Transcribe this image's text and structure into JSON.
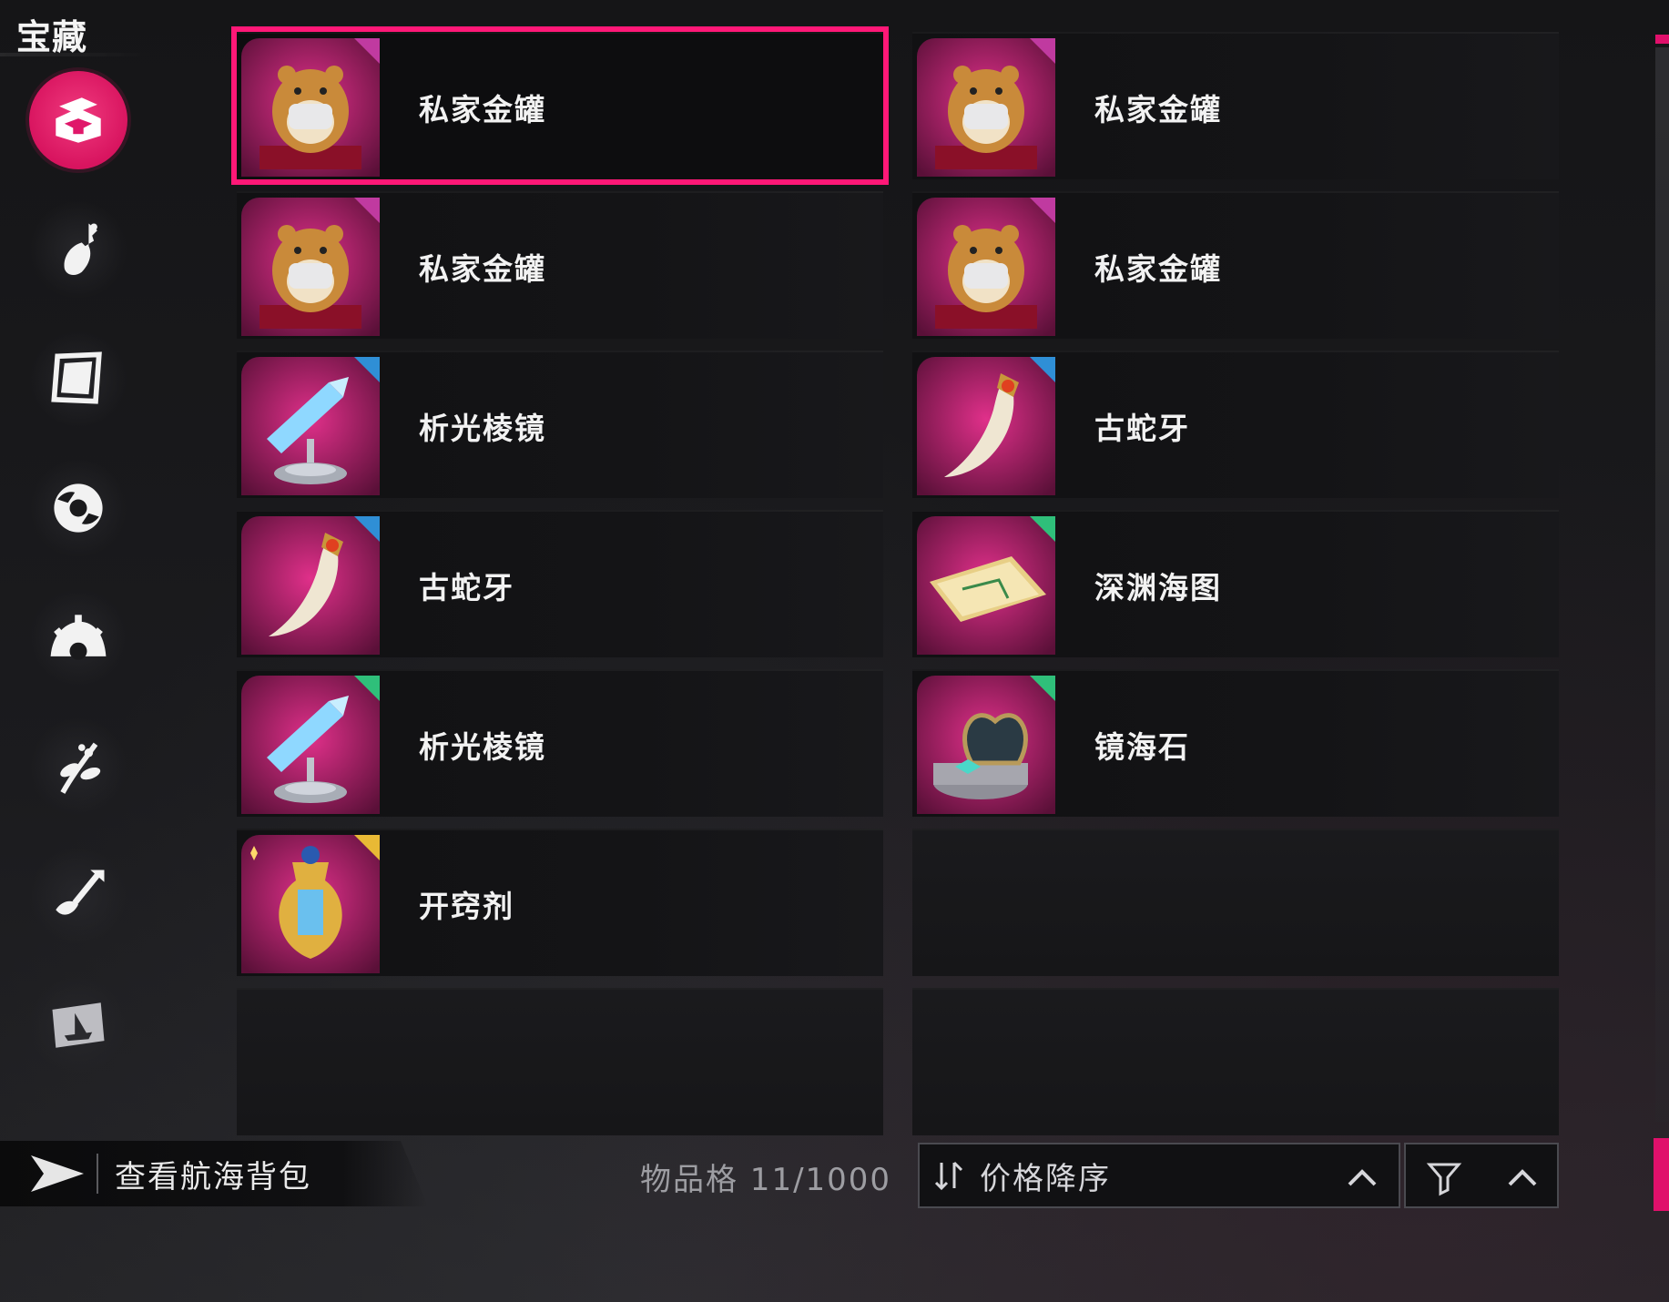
{
  "page_title": "宝藏",
  "colors": {
    "accent": "#ff1877",
    "active_category": "#e0186a",
    "rarity_purple": "#c03aa0",
    "rarity_blue": "#2f8fd6",
    "rarity_green": "#2fbf7a",
    "rarity_gold": "#e8b935"
  },
  "categories": [
    {
      "icon": "treasure-chest-icon",
      "active": true
    },
    {
      "icon": "bottle-icon",
      "active": false
    },
    {
      "icon": "card-frame-icon",
      "active": false
    },
    {
      "icon": "gear-icon",
      "active": false
    },
    {
      "icon": "half-gear-icon",
      "active": false
    },
    {
      "icon": "plant-sprig-icon",
      "active": false
    },
    {
      "icon": "shovel-icon",
      "active": false
    },
    {
      "icon": "sail-map-icon",
      "active": false
    }
  ],
  "items": [
    {
      "name": "私家金罐",
      "art": "hamster-pot",
      "rarity": "purple",
      "selected": true
    },
    {
      "name": "私家金罐",
      "art": "hamster-pot",
      "rarity": "purple",
      "selected": false
    },
    {
      "name": "私家金罐",
      "art": "hamster-pot",
      "rarity": "purple",
      "selected": false
    },
    {
      "name": "私家金罐",
      "art": "hamster-pot",
      "rarity": "purple",
      "selected": false
    },
    {
      "name": "析光棱镜",
      "art": "crystal-prism",
      "rarity": "blue",
      "selected": false
    },
    {
      "name": "古蛇牙",
      "art": "serpent-fang",
      "rarity": "blue",
      "selected": false
    },
    {
      "name": "古蛇牙",
      "art": "serpent-fang",
      "rarity": "blue",
      "selected": false
    },
    {
      "name": "深渊海图",
      "art": "sea-chart",
      "rarity": "green",
      "selected": false
    },
    {
      "name": "析光棱镜",
      "art": "crystal-prism",
      "rarity": "green",
      "selected": false
    },
    {
      "name": "镜海石",
      "art": "jewel-box",
      "rarity": "green",
      "selected": false
    },
    {
      "name": "开窍剂",
      "art": "golden-flask",
      "rarity": "gold",
      "selected": false
    }
  ],
  "bottom": {
    "bag_link_label": "查看航海背包",
    "capacity_label": "物品格 11/1000",
    "sort_label": "价格降序"
  }
}
